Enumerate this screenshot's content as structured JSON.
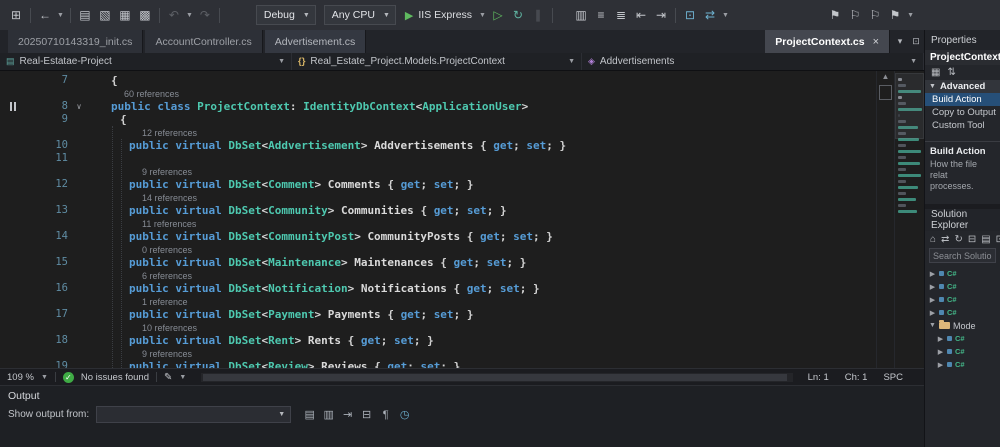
{
  "toolbar": {
    "items": [
      {
        "kind": "icon",
        "name": "start-window-icon",
        "glyph": "⊞"
      },
      {
        "kind": "sep"
      },
      {
        "kind": "icon",
        "name": "navigate-back-icon",
        "glyph": "←"
      },
      {
        "kind": "caret"
      },
      {
        "kind": "sep"
      },
      {
        "kind": "icon",
        "name": "new-file-icon",
        "glyph": "▤"
      },
      {
        "kind": "icon",
        "name": "open-file-icon",
        "glyph": "▧"
      },
      {
        "kind": "icon",
        "name": "save-icon",
        "glyph": "▦"
      },
      {
        "kind": "icon",
        "name": "save-all-icon",
        "glyph": "▩"
      },
      {
        "kind": "sep"
      },
      {
        "kind": "icon",
        "name": "undo-icon",
        "glyph": "↶",
        "disabled": true
      },
      {
        "kind": "caret"
      },
      {
        "kind": "icon",
        "name": "redo-icon",
        "glyph": "↷",
        "disabled": true
      },
      {
        "kind": "sep"
      },
      {
        "kind": "gap",
        "w": 28
      },
      {
        "kind": "dropdown",
        "name": "solution-configurations-dropdown",
        "label": "Debug",
        "w": 44
      },
      {
        "kind": "dropdown",
        "name": "solution-platforms-dropdown",
        "label": "Any CPU",
        "w": 62
      },
      {
        "kind": "run",
        "name": "start-debugging-button",
        "label": "IIS Express"
      },
      {
        "kind": "caret"
      },
      {
        "kind": "icon",
        "name": "start-without-debugging-icon",
        "glyph": "▷",
        "color": "#5fb95f"
      },
      {
        "kind": "icon",
        "name": "hot-reload-icon",
        "glyph": "↻",
        "color": "#5fb3a1"
      },
      {
        "kind": "icon",
        "name": "pause-icon",
        "glyph": "∥",
        "disabled": true
      },
      {
        "kind": "sep"
      },
      {
        "kind": "gap",
        "w": 14
      },
      {
        "kind": "icon",
        "name": "find-in-files-icon",
        "glyph": "▥"
      },
      {
        "kind": "icon",
        "name": "comment-out-icon",
        "glyph": "≡"
      },
      {
        "kind": "icon",
        "name": "uncomment-icon",
        "glyph": "≣"
      },
      {
        "kind": "icon",
        "name": "decrease-indent-icon",
        "glyph": "⇤"
      },
      {
        "kind": "icon",
        "name": "increase-indent-icon",
        "glyph": "⇥"
      },
      {
        "kind": "sep"
      },
      {
        "kind": "icon",
        "name": "code-map-icon",
        "glyph": "⊡",
        "color": "#6fb3d2"
      },
      {
        "kind": "icon",
        "name": "live-share-icon",
        "glyph": "⇄",
        "color": "#6fb3d2"
      },
      {
        "kind": "caret"
      },
      {
        "kind": "spacer"
      },
      {
        "kind": "icon",
        "name": "toggle-bookmark-icon",
        "glyph": "⚑"
      },
      {
        "kind": "icon",
        "name": "prev-bookmark-icon",
        "glyph": "⚐"
      },
      {
        "kind": "icon",
        "name": "next-bookmark-icon",
        "glyph": "⚐"
      },
      {
        "kind": "icon",
        "name": "clear-bookmarks-icon",
        "glyph": "⚑"
      },
      {
        "kind": "caret"
      },
      {
        "kind": "gap",
        "w": 78
      }
    ]
  },
  "tabs": {
    "left": [
      {
        "label": "20250710143319_init.cs",
        "highlight": false
      },
      {
        "label": "AccountController.cs",
        "highlight": false
      },
      {
        "label": "Advertisement.cs",
        "highlight": true
      }
    ],
    "right": {
      "label": "ProjectContext.cs",
      "close_glyph": "×"
    },
    "right_icons": [
      {
        "name": "document-dropdown-icon",
        "glyph": "▾"
      },
      {
        "name": "split-window-icon",
        "glyph": "⊡"
      }
    ]
  },
  "breadcrumb": {
    "crumbs": [
      {
        "glyph": "▤",
        "label": "Real-Estatae-Project"
      },
      {
        "glyph": "{}",
        "label": "Real_Estate_Project.Models.ProjectContext"
      },
      {
        "glyph": "◈",
        "label": "Addvertisements"
      }
    ]
  },
  "editor": {
    "rows": [
      {
        "num": "7",
        "indent": 1,
        "tokens": [
          [
            "{",
            "pn"
          ]
        ]
      },
      {
        "lens": "60 references",
        "indent": 1
      },
      {
        "num": "8",
        "indent": 1,
        "glyph": true,
        "fold": true,
        "tokens": [
          [
            "public ",
            "kw"
          ],
          [
            "class ",
            "kw"
          ],
          [
            "ProjectContext",
            "ty"
          ],
          [
            ": ",
            "pn"
          ],
          [
            "IdentityDbContext",
            "ty"
          ],
          [
            "<",
            "pn"
          ],
          [
            "ApplicationUser",
            "ty"
          ],
          [
            ">",
            "pn"
          ]
        ]
      },
      {
        "num": "9",
        "indent": 2,
        "tokens": [
          [
            "{",
            "pn"
          ]
        ]
      },
      {
        "lens": "12 references",
        "indent": 3
      },
      {
        "num": "10",
        "indent": 3,
        "tokens": [
          [
            "public ",
            "kw"
          ],
          [
            "virtual ",
            "kw"
          ],
          [
            "DbSet",
            "ty"
          ],
          [
            "<",
            "pn"
          ],
          [
            "Addvertisement",
            "ty"
          ],
          [
            "> ",
            "pn"
          ],
          [
            "Addvertisements ",
            "id"
          ],
          [
            "{ ",
            "pn"
          ],
          [
            "get",
            "kw"
          ],
          [
            "; ",
            "pn"
          ],
          [
            "set",
            "kw"
          ],
          [
            "; ",
            "pn"
          ],
          [
            "}",
            "pn"
          ]
        ]
      },
      {
        "num": "11",
        "indent": 0,
        "tokens": []
      },
      {
        "lens": "9 references",
        "indent": 3
      },
      {
        "num": "12",
        "indent": 3,
        "tokens": [
          [
            "public ",
            "kw"
          ],
          [
            "virtual ",
            "kw"
          ],
          [
            "DbSet",
            "ty"
          ],
          [
            "<",
            "pn"
          ],
          [
            "Comment",
            "ty"
          ],
          [
            "> ",
            "pn"
          ],
          [
            "Comments ",
            "id"
          ],
          [
            "{ ",
            "pn"
          ],
          [
            "get",
            "kw"
          ],
          [
            "; ",
            "pn"
          ],
          [
            "set",
            "kw"
          ],
          [
            "; ",
            "pn"
          ],
          [
            "}",
            "pn"
          ]
        ]
      },
      {
        "lens": "14 references",
        "indent": 3
      },
      {
        "num": "13",
        "indent": 3,
        "tokens": [
          [
            "public ",
            "kw"
          ],
          [
            "virtual ",
            "kw"
          ],
          [
            "DbSet",
            "ty"
          ],
          [
            "<",
            "pn"
          ],
          [
            "Community",
            "ty"
          ],
          [
            "> ",
            "pn"
          ],
          [
            "Communities ",
            "id"
          ],
          [
            "{ ",
            "pn"
          ],
          [
            "get",
            "kw"
          ],
          [
            "; ",
            "pn"
          ],
          [
            "set",
            "kw"
          ],
          [
            "; ",
            "pn"
          ],
          [
            "}",
            "pn"
          ]
        ]
      },
      {
        "lens": "11 references",
        "indent": 3
      },
      {
        "num": "14",
        "indent": 3,
        "tokens": [
          [
            "public ",
            "kw"
          ],
          [
            "virtual ",
            "kw"
          ],
          [
            "DbSet",
            "ty"
          ],
          [
            "<",
            "pn"
          ],
          [
            "CommunityPost",
            "ty"
          ],
          [
            "> ",
            "pn"
          ],
          [
            "CommunityPosts ",
            "id"
          ],
          [
            "{ ",
            "pn"
          ],
          [
            "get",
            "kw"
          ],
          [
            "; ",
            "pn"
          ],
          [
            "set",
            "kw"
          ],
          [
            "; ",
            "pn"
          ],
          [
            "}",
            "pn"
          ]
        ]
      },
      {
        "lens": "0 references",
        "indent": 3
      },
      {
        "num": "15",
        "indent": 3,
        "tokens": [
          [
            "public ",
            "kw"
          ],
          [
            "virtual ",
            "kw"
          ],
          [
            "DbSet",
            "ty"
          ],
          [
            "<",
            "pn"
          ],
          [
            "Maintenance",
            "ty"
          ],
          [
            "> ",
            "pn"
          ],
          [
            "Maintenances ",
            "id"
          ],
          [
            "{ ",
            "pn"
          ],
          [
            "get",
            "kw"
          ],
          [
            "; ",
            "pn"
          ],
          [
            "set",
            "kw"
          ],
          [
            "; ",
            "pn"
          ],
          [
            "}",
            "pn"
          ]
        ]
      },
      {
        "lens": "6 references",
        "indent": 3
      },
      {
        "num": "16",
        "indent": 3,
        "tokens": [
          [
            "public ",
            "kw"
          ],
          [
            "virtual ",
            "kw"
          ],
          [
            "DbSet",
            "ty"
          ],
          [
            "<",
            "pn"
          ],
          [
            "Notification",
            "ty"
          ],
          [
            "> ",
            "pn"
          ],
          [
            "Notifications ",
            "id"
          ],
          [
            "{ ",
            "pn"
          ],
          [
            "get",
            "kw"
          ],
          [
            "; ",
            "pn"
          ],
          [
            "set",
            "kw"
          ],
          [
            "; ",
            "pn"
          ],
          [
            "}",
            "pn"
          ]
        ]
      },
      {
        "lens": "1 reference",
        "indent": 3
      },
      {
        "num": "17",
        "indent": 3,
        "tokens": [
          [
            "public ",
            "kw"
          ],
          [
            "virtual ",
            "kw"
          ],
          [
            "DbSet",
            "ty"
          ],
          [
            "<",
            "pn"
          ],
          [
            "Payment",
            "ty"
          ],
          [
            "> ",
            "pn"
          ],
          [
            "Payments ",
            "id"
          ],
          [
            "{ ",
            "pn"
          ],
          [
            "get",
            "kw"
          ],
          [
            "; ",
            "pn"
          ],
          [
            "set",
            "kw"
          ],
          [
            "; ",
            "pn"
          ],
          [
            "}",
            "pn"
          ]
        ]
      },
      {
        "lens": "10 references",
        "indent": 3
      },
      {
        "num": "18",
        "indent": 3,
        "tokens": [
          [
            "public ",
            "kw"
          ],
          [
            "virtual ",
            "kw"
          ],
          [
            "DbSet",
            "ty"
          ],
          [
            "<",
            "pn"
          ],
          [
            "Rent",
            "ty"
          ],
          [
            "> ",
            "pn"
          ],
          [
            "Rents ",
            "id"
          ],
          [
            "{ ",
            "pn"
          ],
          [
            "get",
            "kw"
          ],
          [
            "; ",
            "pn"
          ],
          [
            "set",
            "kw"
          ],
          [
            "; ",
            "pn"
          ],
          [
            "}",
            "pn"
          ]
        ]
      },
      {
        "lens": "9 references",
        "indent": 3
      },
      {
        "num": "19",
        "indent": 3,
        "tokens": [
          [
            "public ",
            "kw"
          ],
          [
            "virtual ",
            "kw"
          ],
          [
            "DbSet",
            "ty"
          ],
          [
            "<",
            "pn"
          ],
          [
            "Review",
            "ty"
          ],
          [
            "> ",
            "pn"
          ],
          [
            "Reviews ",
            "id"
          ],
          [
            "{ ",
            "pn"
          ],
          [
            "get",
            "kw"
          ],
          [
            "; ",
            "pn"
          ],
          [
            "set",
            "kw"
          ],
          [
            "; ",
            "pn"
          ],
          [
            "}",
            "pn"
          ]
        ]
      }
    ]
  },
  "status_bar": {
    "zoom": "109 %",
    "message": "No issues found",
    "line": "Ln: 1",
    "column": "Ch: 1",
    "mode": "SPC"
  },
  "output_panel": {
    "title": "Output",
    "show_output_label": "Show output from:",
    "dropdown_value": "",
    "icons": [
      {
        "name": "output-list-icon",
        "glyph": "▤"
      },
      {
        "name": "messages-icon",
        "glyph": "▥"
      },
      {
        "name": "goto-message-icon",
        "glyph": "⇥"
      },
      {
        "name": "clear-all-icon",
        "glyph": "⊟"
      },
      {
        "name": "toggle-wrap-icon",
        "glyph": "¶"
      },
      {
        "name": "history-icon",
        "glyph": "◷",
        "color": "#6fb3d2"
      }
    ]
  },
  "properties_panel": {
    "title": "Properties",
    "object_name": "ProjectContext.c",
    "tools": [
      {
        "name": "categorized-icon",
        "glyph": "▦"
      },
      {
        "name": "alphabetical-icon",
        "glyph": "⇅"
      }
    ],
    "section_label": "Advanced",
    "rows": [
      {
        "label": "Build Action",
        "selected": true
      },
      {
        "label": "Copy to Output",
        "selected": false
      },
      {
        "label": "Custom Tool",
        "selected": false
      }
    ],
    "description_title": "Build Action",
    "description_line1": "How the file relat",
    "description_line2": "processes."
  },
  "solution_explorer": {
    "title": "Solution Explorer",
    "tools": [
      {
        "name": "home-icon",
        "glyph": "⌂"
      },
      {
        "name": "switch-views-icon",
        "glyph": "⇄"
      },
      {
        "name": "refresh-icon",
        "glyph": "↻"
      },
      {
        "name": "collapse-all-icon",
        "glyph": "⊟"
      },
      {
        "name": "show-all-files-icon",
        "glyph": "▤"
      },
      {
        "name": "properties-icon",
        "glyph": "⊡"
      }
    ],
    "search_placeholder": "Search Solution E",
    "tree": [
      {
        "type": "cs",
        "label": "",
        "indent": 0
      },
      {
        "type": "cs",
        "label": "",
        "indent": 0
      },
      {
        "type": "cs",
        "label": "",
        "indent": 0
      },
      {
        "type": "cs",
        "label": "",
        "indent": 0
      },
      {
        "type": "folder",
        "label": "Mode",
        "indent": 0,
        "expanded": true
      },
      {
        "type": "cs",
        "label": "",
        "indent": 1
      },
      {
        "type": "cs",
        "label": "",
        "indent": 1
      },
      {
        "type": "cs",
        "label": "",
        "indent": 1
      }
    ]
  },
  "colors": {
    "keyword": "#569cd6",
    "type": "#4ec9b0",
    "selection_accent": "#264f78",
    "run_green": "#5fb95f",
    "issues_green": "#3fab45"
  }
}
